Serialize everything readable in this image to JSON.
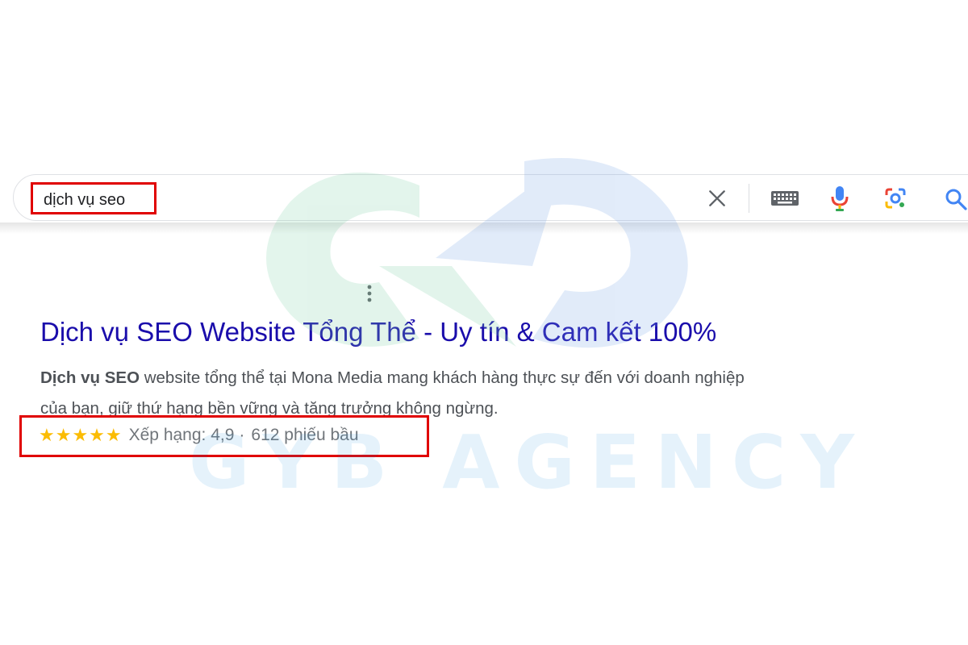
{
  "search": {
    "query": "dịch vụ seo"
  },
  "result": {
    "title": "Dịch vụ SEO Website Tổng Thể - Uy tín & Cam kết 100%",
    "snippet_bold": "Dịch vụ SEO",
    "snippet_line1_rest": " website tổng thể tại Mona Media mang khách hàng thực sự đến với doanh nghiệp",
    "snippet_line2": "của bạn, giữ thứ hạng bền vững và tăng trưởng không ngừng.",
    "rating": {
      "stars": "★★★★★",
      "rating_value": 4.9,
      "rating_text": "Xếp hạng: 4,9",
      "separator": "·",
      "votes_text": "612 phiếu bầu"
    }
  },
  "watermark": {
    "text": "GYB AGENCY"
  },
  "icons": {
    "clear": "close-icon",
    "keyboard": "keyboard-icon",
    "voice": "microphone-icon",
    "lens": "lens-camera-icon",
    "search": "search-icon",
    "more": "more-vert-icon"
  },
  "colors": {
    "link": "#1a0dab",
    "snippet": "#4d5156",
    "star": "#fbbc04",
    "highlight_border": "#e00000"
  }
}
